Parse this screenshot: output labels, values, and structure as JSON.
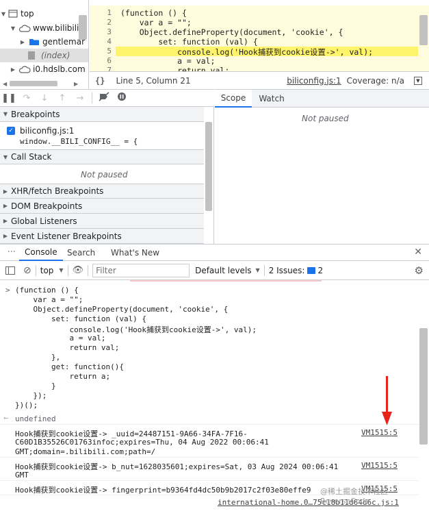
{
  "navigator": {
    "items": [
      {
        "label": "top",
        "icon": "frame-icon"
      },
      {
        "label": "www.bilibili.",
        "icon": "cloud-icon"
      },
      {
        "label": "gentlemar",
        "icon": "folder-icon"
      },
      {
        "label": "(index)",
        "icon": "file-icon"
      },
      {
        "label": "i0.hdslb.com",
        "icon": "cloud-icon"
      }
    ]
  },
  "editor": {
    "line_numbers": [
      "1",
      "2",
      "3",
      "4",
      "5",
      "6",
      "7"
    ],
    "lines": [
      "(function () {",
      "    var a = \"\";",
      "    Object.defineProperty(document, 'cookie', {",
      "        set: function (val) {",
      "            console.log('Hook捕获到cookie设置->', val);",
      "            a = val;",
      "            return val;"
    ],
    "status_position": "Line 5, Column 21",
    "status_file": "biliconfig.js:1",
    "status_coverage": "Coverage: n/a",
    "format_icon": "{}"
  },
  "debugger": {
    "sections": {
      "breakpoints": "Breakpoints",
      "call_stack": "Call Stack",
      "xhr": "XHR/fetch Breakpoints",
      "dom": "DOM Breakpoints",
      "global": "Global Listeners",
      "event": "Event Listener Breakpoints"
    },
    "breakpoint_file": "biliconfig.js:1",
    "breakpoint_code": "window.__BILI_CONFIG__ = {",
    "not_paused": "Not paused",
    "scope_tab": "Scope",
    "watch_tab": "Watch",
    "scope_not_paused": "Not paused"
  },
  "drawer": {
    "tabs": [
      "Console",
      "Search",
      "What's New"
    ]
  },
  "console_toolbar": {
    "context": "top",
    "filter_placeholder": "Filter",
    "levels": "Default levels",
    "issues": "2 Issues:",
    "issues_count": "2"
  },
  "console": {
    "input_lines": [
      "(function () {",
      "    var a = \"\";",
      "    Object.defineProperty(document, 'cookie', {",
      "        set: function (val) {",
      "            console.log('Hook捕获到cookie设置->', val);",
      "            a = val;",
      "            return val;",
      "        },",
      "        get: function(){",
      "            return a;",
      "        }",
      "    });",
      "})();"
    ],
    "result": "undefined",
    "messages": [
      {
        "lines": [
          "Hook捕获到cookie设置-> _uuid=24487151-9A66-34FA-7F16-",
          "C60D1B35526C01763infoc;expires=Thu, 04 Aug 2022 00:06:41",
          "GMT;domain=.bilibili.com;path=/"
        ],
        "source": "VM1515:5"
      },
      {
        "lines": [
          "Hook捕获到cookie设置-> b_nut=1628035601;expires=Sat, 03 Aug 2024 00:06:41",
          "GMT"
        ],
        "source": "VM1515:5"
      },
      {
        "lines": [
          "Hook捕获到cookie设置-> fingerprint=b9364fd4dc50b9b2017c2f03e80effe9"
        ],
        "source": "VM1515:5"
      }
    ],
    "last_source": "international-home.0…75c18b11d64d6c.js:1",
    "watermark": "@稀土掘金技术社区 ReverseCode"
  },
  "colors": {
    "accent": "#1a73e8",
    "arrow": "#e8231b",
    "highlight": "#fff36b",
    "editor_bg": "#fffbdd"
  }
}
